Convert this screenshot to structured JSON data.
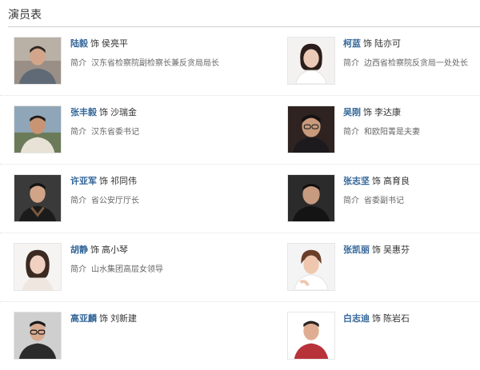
{
  "section": {
    "title": "演员表"
  },
  "cast": [
    {
      "actor": "陆毅",
      "as": "饰",
      "role": "侯亮平",
      "intro_label": "简介",
      "intro": "汉东省检察院副检察长兼反贪局局长"
    },
    {
      "actor": "柯蓝",
      "as": "饰",
      "role": "陆亦可",
      "intro_label": "简介",
      "intro": "边西省检察院反贪局一处处长"
    },
    {
      "actor": "张丰毅",
      "as": "饰",
      "role": "沙瑞金",
      "intro_label": "简介",
      "intro": "汉东省委书记"
    },
    {
      "actor": "吴刚",
      "as": "饰",
      "role": "李达康",
      "intro_label": "简介",
      "intro": "和欧阳菁是夫妻"
    },
    {
      "actor": "许亚军",
      "as": "饰",
      "role": "祁同伟",
      "intro_label": "简介",
      "intro": "省公安厅厅长"
    },
    {
      "actor": "张志坚",
      "as": "饰",
      "role": "高育良",
      "intro_label": "简介",
      "intro": "省委副书记"
    },
    {
      "actor": "胡静",
      "as": "饰",
      "role": "高小琴",
      "intro_label": "简介",
      "intro": "山水集团高层女领导"
    },
    {
      "actor": "张凯丽",
      "as": "饰",
      "role": "吴惠芬",
      "intro_label": "",
      "intro": ""
    },
    {
      "actor": "高亚麟",
      "as": "饰",
      "role": "刘新建",
      "intro_label": "",
      "intro": ""
    },
    {
      "actor": "白志迪",
      "as": "饰",
      "role": "陈岩石",
      "intro_label": "",
      "intro": ""
    }
  ],
  "colors": {
    "actor_link": "#336699",
    "rule": "#cfcfcf"
  }
}
